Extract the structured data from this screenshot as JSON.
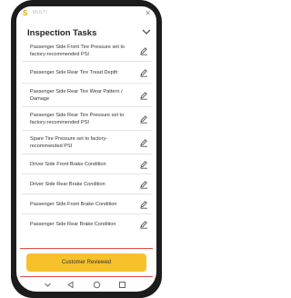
{
  "status_bar": {
    "app_label": "MULTI",
    "close_glyph": "✕",
    "app_icon": "s-logo-icon"
  },
  "header": {
    "title": "Inspection Tasks"
  },
  "tasks": [
    {
      "label": "Passenger Side Front Tire Pressure set to factory-recommended PSI"
    },
    {
      "label": "Passenger Side Rear Tire Tread Depth"
    },
    {
      "label": "Passenger Side Rear Tire Wear Pattern / Damage"
    },
    {
      "label": "Passenger Side Rear Tire Pressure set to factory-recommended PSI"
    },
    {
      "label": "Spare Tire Pressure set to factory-recommended PSI"
    },
    {
      "label": "Driver Side Front Brake Condition"
    },
    {
      "label": "Driver Side Rear Brake Condition"
    },
    {
      "label": "Passenger Side Front Brake Condition"
    },
    {
      "label": "Passenger Side Rear Brake Condition"
    }
  ],
  "footer": {
    "primary_button": "Customer Reviewed"
  },
  "colors": {
    "accent": "#f6c12b",
    "highlight_border": "#e54b4b",
    "phone_frame": "#1c1c1c"
  }
}
